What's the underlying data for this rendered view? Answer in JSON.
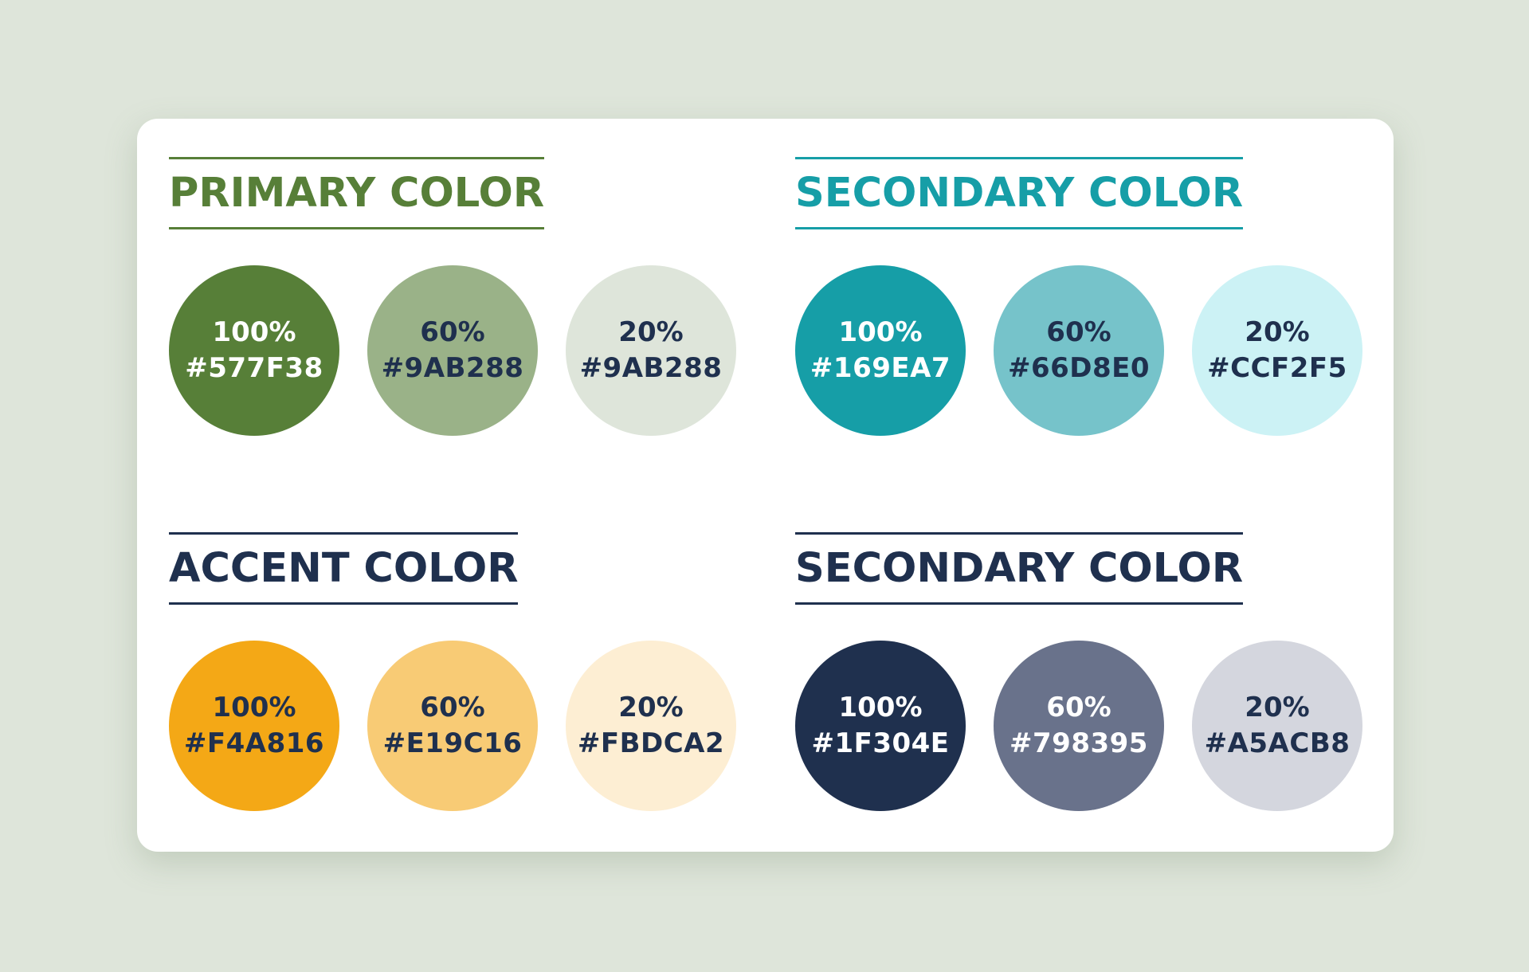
{
  "colors": {
    "page_bg": "#DEE5DA",
    "card_bg": "#FFFFFF",
    "light_text": "#FFFFFF",
    "dark_text": "#1F304E"
  },
  "groups": [
    {
      "title": "PRIMARY COLOR",
      "title_color": "#577F38",
      "swatches": [
        {
          "percent": "100%",
          "hex_label": "#577F38",
          "fill": "#577F38",
          "text_color": "#FFFFFF"
        },
        {
          "percent": "60%",
          "hex_label": "#9AB288",
          "fill": "#9AB288",
          "text_color": "#1F304E"
        },
        {
          "percent": "20%",
          "hex_label": "#9AB288",
          "fill": "#DEE5DA",
          "text_color": "#1F304E"
        }
      ]
    },
    {
      "title": "SECONDARY COLOR",
      "title_color": "#169EA7",
      "swatches": [
        {
          "percent": "100%",
          "hex_label": "#169EA7",
          "fill": "#169EA7",
          "text_color": "#FFFFFF"
        },
        {
          "percent": "60%",
          "hex_label": "#66D8E0",
          "fill": "#76C3CA",
          "text_color": "#1F304E"
        },
        {
          "percent": "20%",
          "hex_label": "#CCF2F5",
          "fill": "#CCF2F5",
          "text_color": "#1F304E"
        }
      ]
    },
    {
      "title": "ACCENT COLOR",
      "title_color": "#1F304E",
      "swatches": [
        {
          "percent": "100%",
          "hex_label": "#F4A816",
          "fill": "#F4A816",
          "text_color": "#1F304E"
        },
        {
          "percent": "60%",
          "hex_label": "#E19C16",
          "fill": "#F8CB75",
          "text_color": "#1F304E"
        },
        {
          "percent": "20%",
          "hex_label": "#FBDCA2",
          "fill": "#FDEED3",
          "text_color": "#1F304E"
        }
      ]
    },
    {
      "title": "SECONDARY COLOR",
      "title_color": "#1F304E",
      "swatches": [
        {
          "percent": "100%",
          "hex_label": "#1F304E",
          "fill": "#1F304E",
          "text_color": "#FFFFFF"
        },
        {
          "percent": "60%",
          "hex_label": "#798395",
          "fill": "#69728B",
          "text_color": "#FFFFFF"
        },
        {
          "percent": "20%",
          "hex_label": "#A5ACB8",
          "fill": "#D4D6DE",
          "text_color": "#1F304E"
        }
      ]
    }
  ]
}
